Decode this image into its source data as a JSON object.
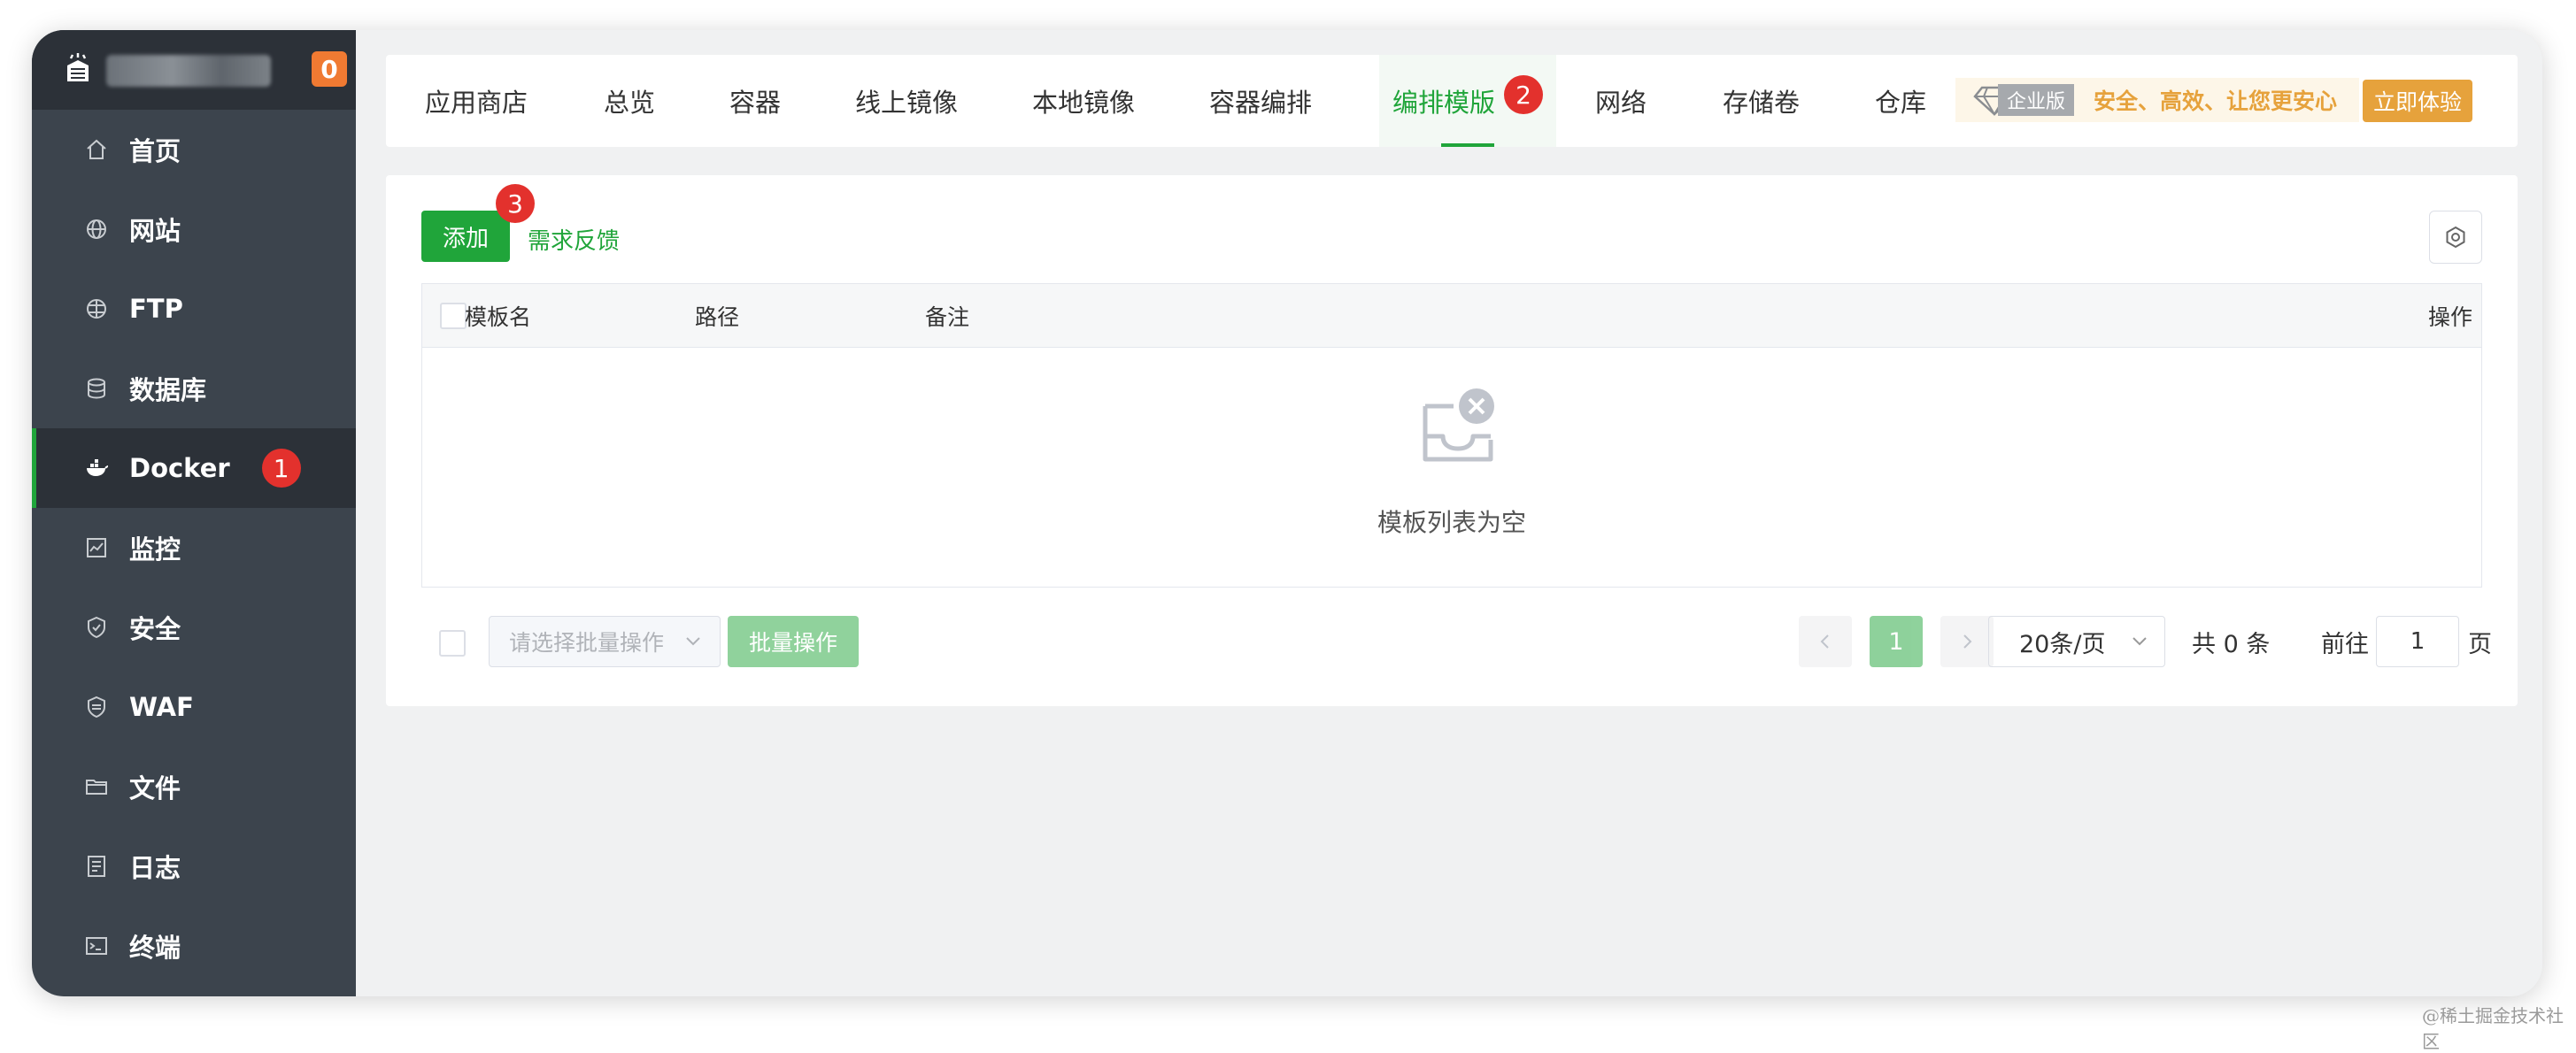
{
  "sidebar": {
    "message_count": "0",
    "items": [
      {
        "label": "首页",
        "icon": "home-icon"
      },
      {
        "label": "网站",
        "icon": "globe-icon"
      },
      {
        "label": "FTP",
        "icon": "ftp-globe-icon"
      },
      {
        "label": "数据库",
        "icon": "database-icon"
      },
      {
        "label": "Docker",
        "icon": "docker-icon",
        "marker": "1"
      },
      {
        "label": "监控",
        "icon": "monitor-icon"
      },
      {
        "label": "安全",
        "icon": "shield-icon"
      },
      {
        "label": "WAF",
        "icon": "waf-shield-icon"
      },
      {
        "label": "文件",
        "icon": "folder-icon"
      },
      {
        "label": "日志",
        "icon": "log-icon"
      },
      {
        "label": "终端",
        "icon": "terminal-icon"
      }
    ]
  },
  "tabs": [
    {
      "label": "应用商店"
    },
    {
      "label": "总览"
    },
    {
      "label": "容器"
    },
    {
      "label": "线上镜像"
    },
    {
      "label": "本地镜像"
    },
    {
      "label": "容器编排"
    },
    {
      "label": "编排模版",
      "active": true,
      "marker": "2"
    },
    {
      "label": "网络"
    },
    {
      "label": "存储卷"
    },
    {
      "label": "仓库"
    }
  ],
  "enterprise": {
    "label": "企业版",
    "slogan": "安全、高效、让您更安心",
    "try_button": "立即体验"
  },
  "toolbar": {
    "add_label": "添加",
    "add_marker": "3",
    "feedback_label": "需求反馈"
  },
  "table": {
    "columns": [
      "模板名",
      "路径",
      "备注",
      "操作"
    ],
    "empty_text": "模板列表为空"
  },
  "footer": {
    "batch_placeholder": "请选择批量操作",
    "batch_button": "批量操作",
    "current_page": "1",
    "page_size": "20条/页",
    "total_text": "共 0 条",
    "goto_label": "前往",
    "goto_value": "1",
    "page_unit": "页"
  },
  "watermark": "@稀土掘金技术社区",
  "colors": {
    "accent": "#20a53a",
    "sidebar_bg": "#3c444d",
    "sidebar_header_bg": "#2c3138",
    "marker_red": "#e3312d",
    "enterprise_gold": "#e6a23c",
    "badge_orange": "#f07a32"
  }
}
